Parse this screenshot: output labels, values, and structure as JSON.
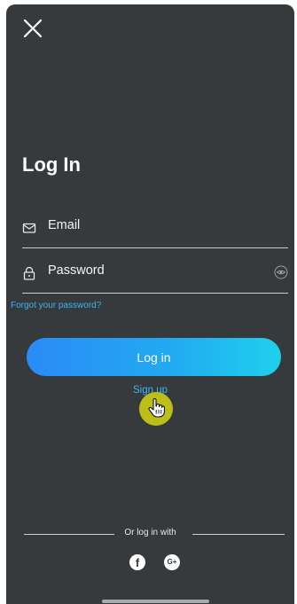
{
  "login": {
    "title": "Log In",
    "email_label": "Email",
    "password_label": "Password",
    "forgot_password": "Forgot your password?",
    "login_button": "Log in",
    "signup_link": "Sign up",
    "social_divider": "Or log in with"
  },
  "icons": {
    "close": "close-icon",
    "email": "envelope-icon",
    "password": "lock-icon",
    "show_password": "eye-icon",
    "facebook": "facebook-icon",
    "facebook_glyph": "f",
    "google": "google-plus-icon",
    "google_glyph": "G+",
    "cursor": "hand-pointer-icon"
  },
  "colors": {
    "background": "#363a3d",
    "link": "#39b6f2",
    "button_gradient_start": "#2a8bf7",
    "button_gradient_end": "#1fd0ec",
    "cursor_highlight": "#d0d016"
  }
}
